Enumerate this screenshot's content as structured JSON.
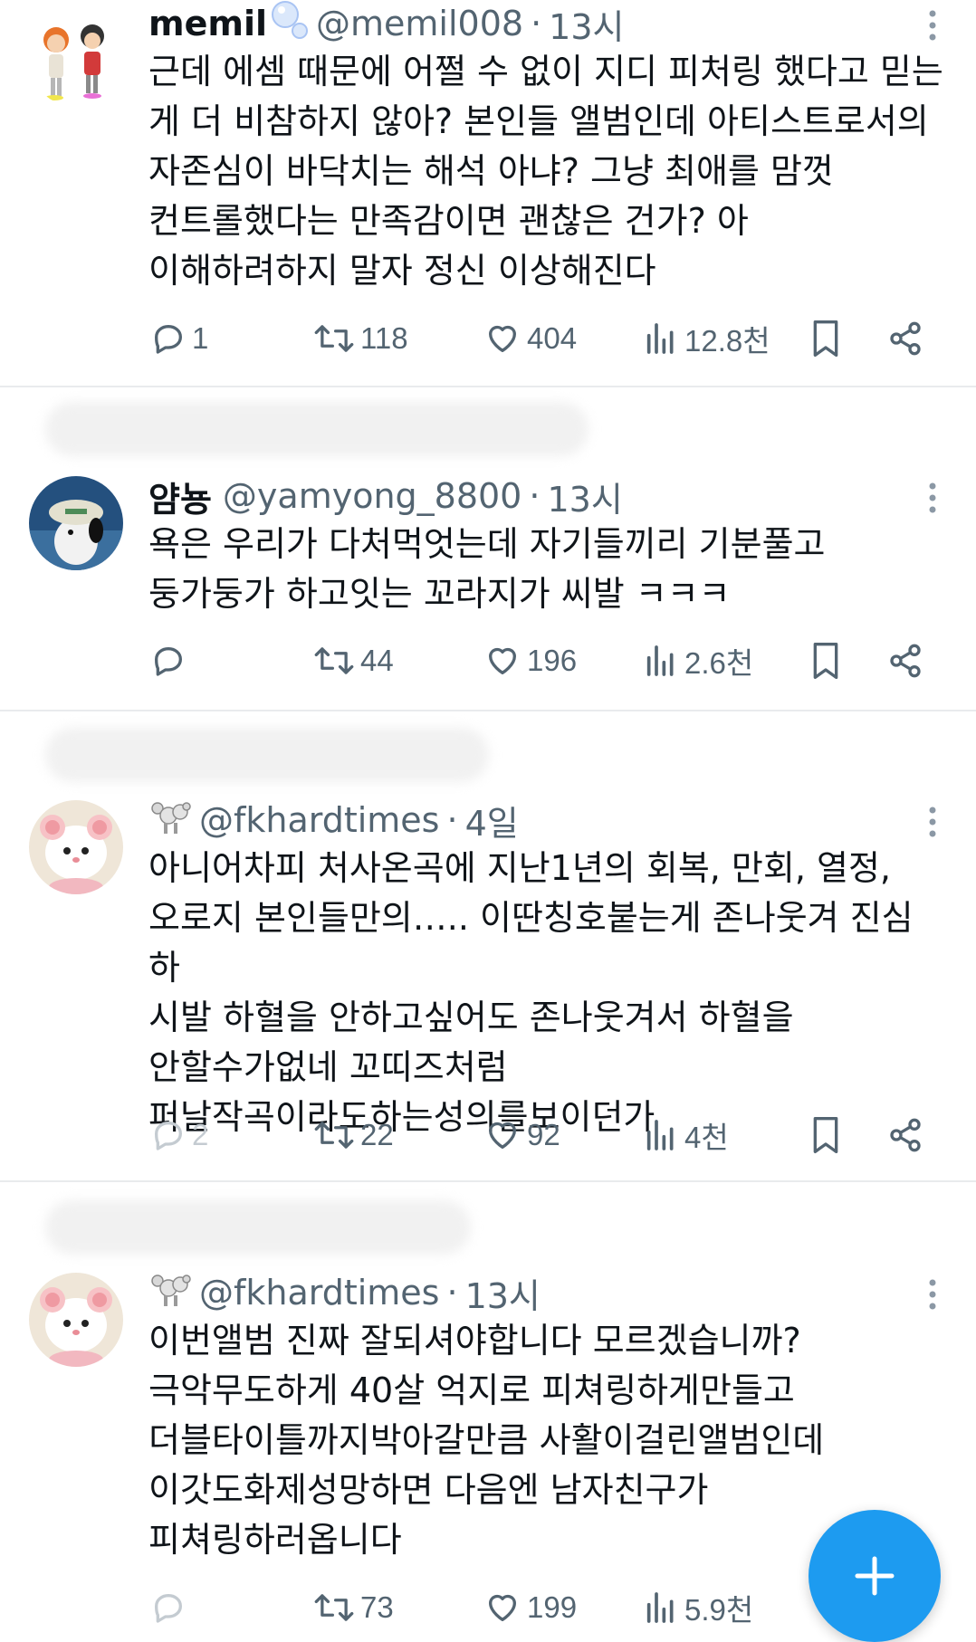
{
  "posts": [
    {
      "name": "memil",
      "handle": "@memil008",
      "time": "13시",
      "text": "근데 에셈 때문에 어쩔 수 없이 지디 피처링 했다고 믿는\n게 더 비참하지 않아? 본인들 앨범인데 아티스트로서의\n자존심이 바닥치는 해석 아냐? 그냥 최애를 맘껏\n컨트롤했다는 만족감이면 괜찮은 건가? 아\n이해하려하지 말자 정신 이상해진다",
      "replies": "1",
      "retweets": "118",
      "likes": "404",
      "views": "12.8천"
    },
    {
      "name": "얌뇽",
      "handle": "@yamyong_8800",
      "time": "13시",
      "text": "욕은 우리가 다처먹엇는데 자기들끼리 기분풀고\n둥가둥가 하고잇는 꼬라지가 씨발 ㅋㅋㅋ",
      "replies": "",
      "retweets": "44",
      "likes": "196",
      "views": "2.6천"
    },
    {
      "name": "",
      "handle": "@fkhardtimes",
      "time": "4일",
      "text": "아니어차피 처사온곡에 지난1년의 회복, 만회, 열정,\n오로지 본인들만의….. 이딴칭호붙는게 존나웃겨 진심 하\n시발 하혈을 안하고싶어도 존나웃겨서 하혈을\n안할수가없네 꼬띠즈처럼\n퍼날작곡이라도하는성의를보이던가",
      "replies": "2",
      "retweets": "22",
      "likes": "92",
      "views": "4천"
    },
    {
      "name": "",
      "handle": "@fkhardtimes",
      "time": "13시",
      "text": "이번앨범 진짜 잘되셔야합니다 모르겠습니까?\n극악무도하게 40살 억지로 피쳐링하게만들고\n더블타이틀까지박아갈만큼 사활이걸린앨범인데\n이갓도화제성망하면 다음엔 남자친구가\n피쳐링하러옵니다",
      "replies": "",
      "retweets": "73",
      "likes": "199",
      "views": "5.9천"
    }
  ],
  "icons": {
    "reply": "reply-icon",
    "retweet": "retweet-icon",
    "like": "heart-icon",
    "views": "views-icon",
    "bookmark": "bookmark-icon",
    "share": "share-icon",
    "more": "more-icon",
    "compose": "plus-icon"
  },
  "colors": {
    "accent": "#1d9bf0",
    "muted": "#536471",
    "text": "#0f1419"
  }
}
